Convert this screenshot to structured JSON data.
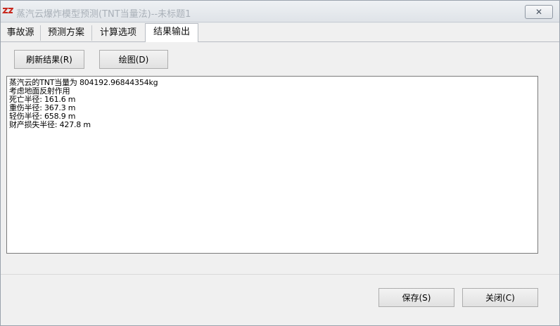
{
  "window": {
    "title": "蒸汽云爆炸模型预测(TNT当量法)--未标题1",
    "close_label": "✕"
  },
  "tabs": [
    {
      "label": "事故源"
    },
    {
      "label": "预测方案"
    },
    {
      "label": "计算选项"
    },
    {
      "label": "结果输出",
      "active": true
    }
  ],
  "toolbar": {
    "refresh_label": "刷新结果(R)",
    "plot_label": "绘图(D)"
  },
  "output": {
    "lines": [
      "蒸汽云的TNT当量为 804192.96844354kg",
      "考虑地面反射作用",
      "死亡半径: 161.6 m",
      "重伤半径: 367.3 m",
      "轻伤半径: 658.9 m",
      "财产损失半径: 427.8 m"
    ]
  },
  "footer": {
    "save_label": "保存(S)",
    "close_label": "关闭(C)"
  },
  "colors": {
    "title_text": "#a9b0b8",
    "icon_red": "#c8281e",
    "panel_bg": "#f0f0f0"
  }
}
